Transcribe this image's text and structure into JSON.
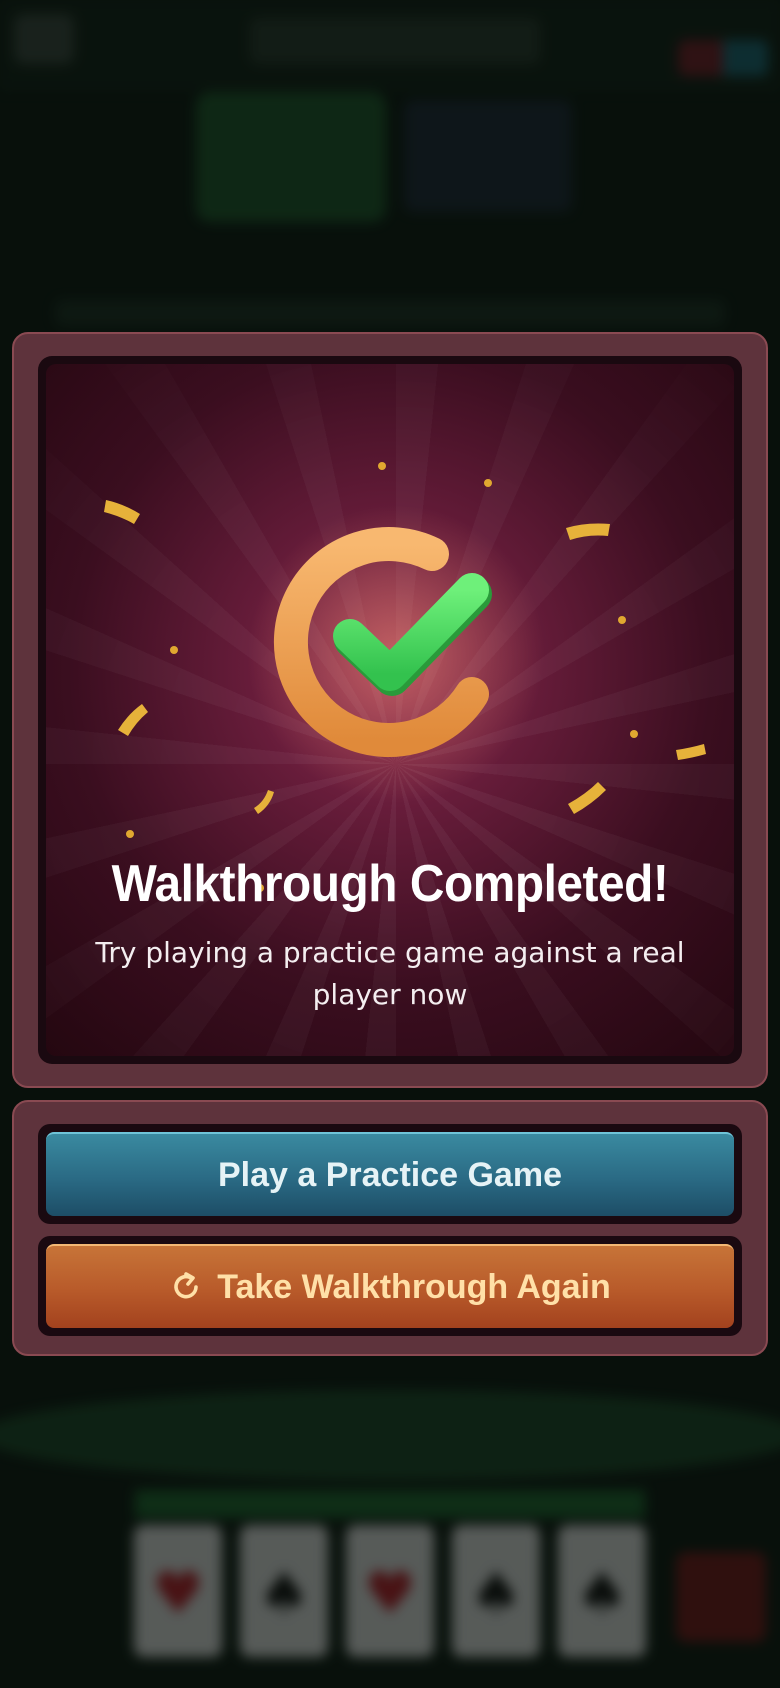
{
  "modal": {
    "headline": "Walkthrough Completed!",
    "subtitle": "Try playing a practice game against a real player now",
    "emblem_icon": "check-badge-icon",
    "colors": {
      "panel": "#5e333c",
      "check": "#4ee06a",
      "ring": "#f2a45a",
      "confetti": "#e6b23a"
    }
  },
  "actions": {
    "practice_label": "Play a Practice Game",
    "again_label": "Take Walkthrough Again",
    "again_icon": "refresh-icon",
    "colors": {
      "practice": "#2a6a84",
      "again": "#b85a2a"
    }
  }
}
